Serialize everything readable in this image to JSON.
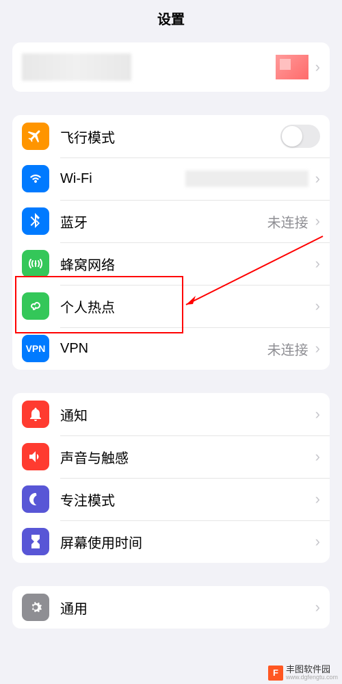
{
  "header": {
    "title": "设置"
  },
  "groups": {
    "network": {
      "airplane": {
        "label": "飞行模式"
      },
      "wifi": {
        "label": "Wi-Fi"
      },
      "bluetooth": {
        "label": "蓝牙",
        "detail": "未连接"
      },
      "cellular": {
        "label": "蜂窝网络"
      },
      "hotspot": {
        "label": "个人热点"
      },
      "vpn": {
        "label": "VPN",
        "badge": "VPN",
        "detail": "未连接"
      }
    },
    "alerts": {
      "notifications": {
        "label": "通知"
      },
      "sound": {
        "label": "声音与触感"
      },
      "focus": {
        "label": "专注模式"
      },
      "screentime": {
        "label": "屏幕使用时间"
      }
    },
    "general": {
      "general": {
        "label": "通用"
      }
    }
  },
  "watermark": {
    "name": "丰图软件园",
    "url": "www.dgfengtu.com",
    "logo": "F"
  }
}
